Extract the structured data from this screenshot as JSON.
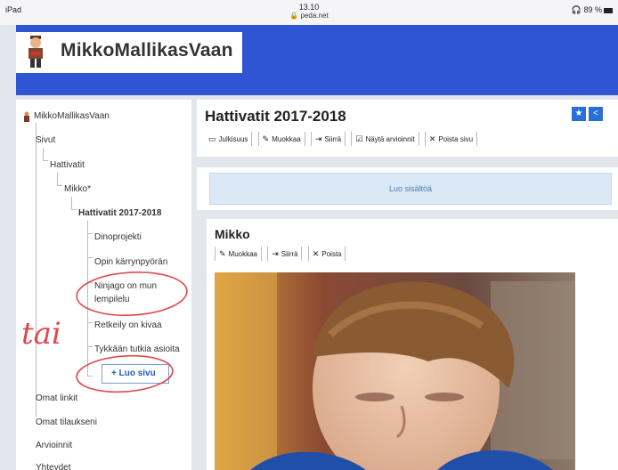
{
  "statusbar": {
    "device": "iPad",
    "time": "13.10",
    "url": "peda.net",
    "battery": "89 %"
  },
  "banner": {
    "site_name": "MikkoMallikasVaan"
  },
  "sidebar": {
    "items": [
      {
        "label": "MikkoMallikasVaan"
      },
      {
        "label": "Sivut"
      },
      {
        "label": "Hattivatit"
      },
      {
        "label": "Mikko*"
      },
      {
        "label": "Hattivatit 2017-2018"
      },
      {
        "label": "Dinoprojekti"
      },
      {
        "label": "Opin kärrynpyörän"
      },
      {
        "label": "Ninjago on mun"
      },
      {
        "label": "lempilelu"
      },
      {
        "label": "Retkeily on kivaa"
      },
      {
        "label": "Tykkään tutkia asioita"
      },
      {
        "label": "Omat linkit"
      },
      {
        "label": "Omat tilaukseni"
      },
      {
        "label": "Arvioinnit"
      },
      {
        "label": "Yhteydet"
      }
    ],
    "create_page": "+ Luo sivu"
  },
  "page": {
    "title": "Hattivatit 2017-2018",
    "toolbar": {
      "visibility": "Julkisuus",
      "edit": "Muokkaa",
      "move": "Siirrä",
      "show_reviews": "Näytä arvioinnit",
      "delete_page": "Poista sivu"
    },
    "create_content": "Luo sisältöä"
  },
  "card": {
    "title": "Mikko",
    "toolbar": {
      "edit": "Muokkaa",
      "move": "Siirrä",
      "delete": "Poista"
    }
  },
  "annotation": {
    "handwritten": "tai"
  },
  "colors": {
    "banner": "#2f55d4",
    "accent": "#2a6fd6",
    "annotation": "#e0484e"
  }
}
